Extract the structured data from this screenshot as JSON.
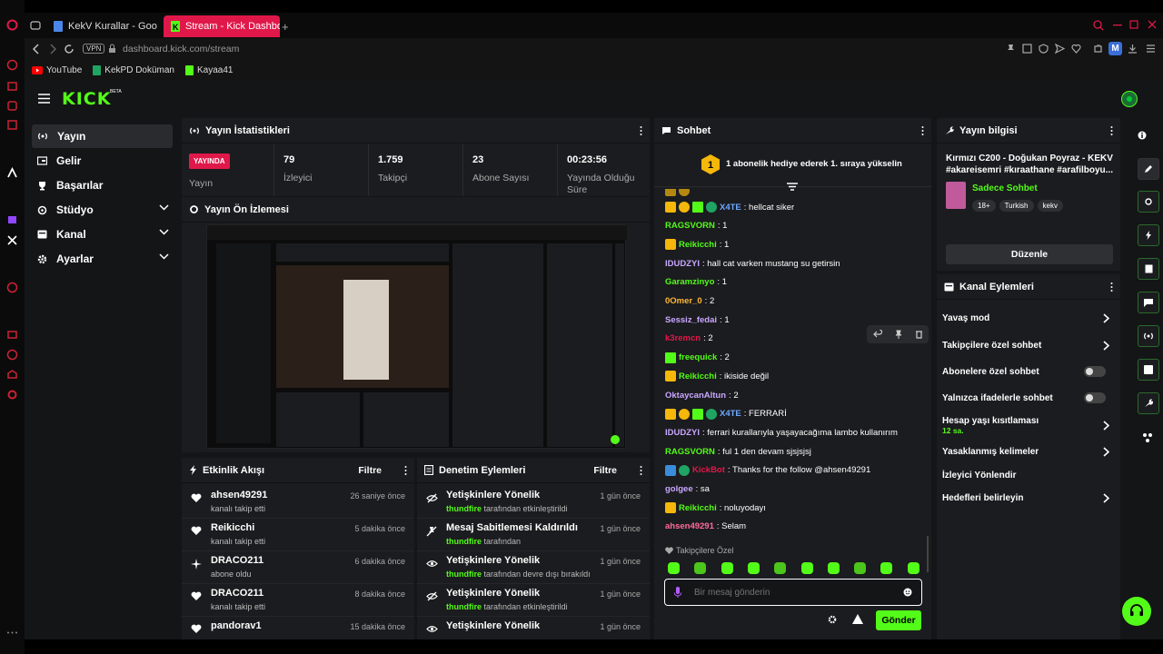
{
  "browser": {
    "tabs": [
      {
        "label": "KekV Kurallar - Google Do"
      },
      {
        "label": "Stream - Kick Dashboard"
      }
    ],
    "vpn_label": "VPN",
    "url": "dashboard.kick.com/stream",
    "bookmarks": [
      {
        "label": "YouTube",
        "icon": "youtube-icon"
      },
      {
        "label": "KekPD Doküman",
        "icon": "sheets-icon"
      },
      {
        "label": "Kayaa41",
        "icon": "kick-icon"
      }
    ],
    "profile_letter": "M"
  },
  "app": {
    "logo": "KICK",
    "logo_badge": "BETA",
    "colors": {
      "accent": "#53fc18",
      "live": "#e0184a",
      "bg": "#141517",
      "panel": "#1b1c1f"
    }
  },
  "nav": {
    "items": [
      {
        "label": "Yayın"
      },
      {
        "label": "Gelir"
      },
      {
        "label": "Başarılar"
      },
      {
        "label": "Stüdyo"
      },
      {
        "label": "Kanal"
      },
      {
        "label": "Ayarlar"
      }
    ]
  },
  "stats": {
    "title": "Yayın İstatistikleri",
    "live_badge": "YAYINDA",
    "live_label": "Yayın",
    "viewers_value": "79",
    "viewers_label": "İzleyici",
    "followers_value": "1.759",
    "followers_label": "Takipçi",
    "subs_value": "23",
    "subs_label": "Abone Sayısı",
    "uptime_value": "00:23:56",
    "uptime_label": "Yayında Olduğu Süre"
  },
  "preview": {
    "title": "Yayın Ön İzlemesi"
  },
  "activity": {
    "title": "Etkinlik Akışı",
    "filter": "Filtre",
    "items": [
      {
        "name": "ahsen49291",
        "desc": "kanalı takip etti",
        "time": "26 saniye önce"
      },
      {
        "name": "Reikicchi",
        "desc": "kanalı takip etti",
        "time": "5 dakika önce"
      },
      {
        "name": "DRACO211",
        "desc": "abone oldu",
        "time": "6 dakika önce"
      },
      {
        "name": "DRACO211",
        "desc": "kanalı takip etti",
        "time": "8 dakika önce"
      },
      {
        "name": "pandorav1",
        "desc": "",
        "time": "15 dakika önce"
      }
    ]
  },
  "moderation": {
    "title": "Denetim Eylemleri",
    "filter": "Filtre",
    "items": [
      {
        "title": "Yetişkinlere Yönelik",
        "user": "thundfire",
        "desc": "tarafından etkinleştirildi",
        "time": "1 gün önce"
      },
      {
        "title": "Mesaj Sabitlemesi Kaldırıldı",
        "user": "thundfire",
        "desc": "tarafından",
        "time": "1 gün önce"
      },
      {
        "title": "Yetişkinlere Yönelik",
        "user": "thundfire",
        "desc": "tarafından devre dışı bırakıldı",
        "time": "1 gün önce"
      },
      {
        "title": "Yetişkinlere Yönelik",
        "user": "thundfire",
        "desc": "tarafından etkinleştirildi",
        "time": "1 gün önce"
      },
      {
        "title": "Yetişkinlere Yönelik",
        "user": "",
        "desc": "",
        "time": "1 gün önce"
      }
    ]
  },
  "chat": {
    "title": "Sohbet",
    "banner_rank": "1",
    "banner": "1 abonelik hediye ederek 1. sıraya yükselin",
    "messages": [
      {
        "user": "X4TE",
        "text": ": hellcat siker",
        "color": "#6ea8ff",
        "badges": [
          "crown",
          "gift",
          "spark",
          "verified"
        ]
      },
      {
        "user": "RAGSVORN",
        "text": ": 1",
        "color": "#53fc18",
        "badges": []
      },
      {
        "user": "Reikicchi",
        "text": ": 1",
        "color": "#53fc18",
        "badges": [
          "crown"
        ]
      },
      {
        "user": "IDUDZYI",
        "text": ": hall cat varken mustang su getirsin",
        "color": "#c9a7ff",
        "badges": []
      },
      {
        "user": "Garamzinyo",
        "text": ": 1",
        "color": "#53fc18",
        "badges": []
      },
      {
        "user": "0Omer_0",
        "text": ": 2",
        "color": "#ffb833",
        "badges": []
      },
      {
        "user": "Sessiz_fedai",
        "text": ": 1",
        "color": "#c9a7ff",
        "badges": []
      },
      {
        "user": "k3remcn",
        "text": ": 2",
        "color": "#e0184a",
        "badges": []
      },
      {
        "user": "freequick",
        "text": ": 2",
        "color": "#53fc18",
        "badges": [
          "spark"
        ]
      },
      {
        "user": "Reikicchi",
        "text": ": ikiside değil",
        "color": "#53fc18",
        "badges": [
          "crown"
        ]
      },
      {
        "user": "OktaycanAltun",
        "text": ": 2",
        "color": "#c9a7ff",
        "badges": []
      },
      {
        "user": "X4TE",
        "text": ": FERRARİ",
        "color": "#6ea8ff",
        "badges": [
          "crown",
          "gift",
          "spark",
          "verified"
        ]
      },
      {
        "user": "IDUDZYI",
        "text": ": ferrari kurallarıyla yaşayacağıma lambo kullanırım",
        "color": "#c9a7ff",
        "badges": []
      },
      {
        "user": "RAGSVORN",
        "text": ": ful 1 den devam sjsjsjsj",
        "color": "#53fc18",
        "badges": []
      },
      {
        "user": "KickBot",
        "text": ": Thanks for the follow @ahsen49291",
        "color": "#e0184a",
        "badges": [
          "bot",
          "verified"
        ]
      },
      {
        "user": "golgee",
        "text": ": sa",
        "color": "#c9a7ff",
        "badges": []
      },
      {
        "user": "Reikicchi",
        "text": ": noluyodayı",
        "color": "#53fc18",
        "badges": [
          "crown"
        ]
      },
      {
        "user": "ahsen49291",
        "text": ": Selam",
        "color": "#ff6b9a",
        "badges": []
      }
    ],
    "followers_only": "Takipçilere Özel",
    "input_placeholder": "Bir mesaj gönderin",
    "send": "Gönder"
  },
  "stream_info": {
    "title": "Yayın bilgisi",
    "stream_title": "Kırmızı C200 - Doğukan Poyraz - KEKV #akareisemri #kıraathane #arafilboyu...",
    "category": "Sadece Sohbet",
    "tags": [
      "18+",
      "Turkish",
      "kekv"
    ],
    "edit": "Düzenle"
  },
  "channel_actions": {
    "title": "Kanal Eylemleri",
    "items": [
      {
        "label": "Yavaş mod",
        "control": "chevron"
      },
      {
        "label": "Takipçilere özel sohbet",
        "control": "chevron"
      },
      {
        "label": "Abonelere özel sohbet",
        "control": "toggle"
      },
      {
        "label": "Yalnızca ifadelerle sohbet",
        "control": "toggle"
      },
      {
        "label": "Hesap yaşı kısıtlaması",
        "sub": "12 sa.",
        "control": "chevron"
      },
      {
        "label": "Yasaklanmış kelimeler",
        "control": "chevron"
      },
      {
        "label": "İzleyici Yönlendir",
        "control": "none"
      },
      {
        "label": "Hedefleri belirleyin",
        "control": "chevron"
      }
    ]
  }
}
